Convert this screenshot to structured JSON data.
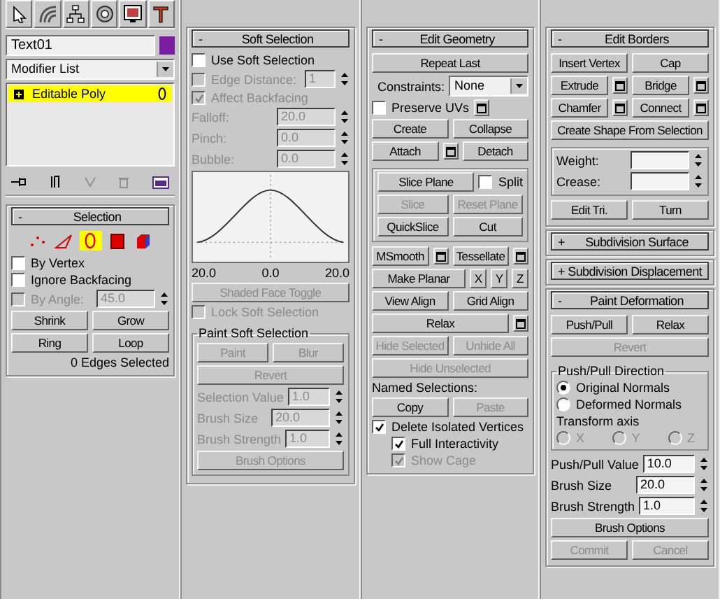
{
  "object": {
    "name": "Text01",
    "color": "#7b1fa2"
  },
  "modifier_list": {
    "value": "Modifier List"
  },
  "stack": [
    {
      "label": "Editable Poly",
      "selected": true
    }
  ],
  "columns": [
    {
      "rollouts": [
        {
          "toggle": "-",
          "title": "Selection",
          "items": [
            {
              "kind": "subobjects",
              "levels": [
                {
                  "kind": "vertex",
                  "selected": false
                },
                {
                  "kind": "edge",
                  "selected": false
                },
                {
                  "kind": "border",
                  "selected": true
                },
                {
                  "kind": "polygon",
                  "selected": false
                },
                {
                  "kind": "element",
                  "selected": false
                }
              ]
            },
            {
              "kind": "checkbox",
              "label": "By Vertex",
              "checked": false,
              "disabled": false
            },
            {
              "kind": "checkbox",
              "label": "Ignore Backfacing",
              "checked": false,
              "disabled": false
            },
            {
              "kind": "checkspinner",
              "label": "By Angle:",
              "value": "45.0",
              "checked": false,
              "disabled": true
            },
            {
              "kind": "row",
              "cells": [
                {
                  "kind": "button",
                  "label": "Shrink",
                  "disabled": false
                },
                {
                  "kind": "button",
                  "label": "Grow",
                  "disabled": false
                }
              ]
            },
            {
              "kind": "row",
              "cells": [
                {
                  "kind": "button",
                  "label": "Ring",
                  "disabled": false
                },
                {
                  "kind": "button",
                  "label": "Loop",
                  "disabled": false
                }
              ]
            },
            {
              "kind": "label",
              "text": "0 Edges Selected",
              "disabled": false
            }
          ]
        }
      ]
    },
    {
      "rollouts": [
        {
          "toggle": "-",
          "title": "Soft Selection",
          "items": [
            {
              "kind": "checkbox",
              "label": "Use Soft Selection",
              "checked": false,
              "disabled": false
            },
            {
              "kind": "checkspinner",
              "label": "Edge Distance:",
              "value": "1",
              "checked": false,
              "disabled": true
            },
            {
              "kind": "checkbox",
              "label": "Affect Backfacing",
              "checked": true,
              "disabled": true
            },
            {
              "kind": "spinner",
              "label": "Falloff:",
              "value": "20.0",
              "disabled": true
            },
            {
              "kind": "spinner",
              "label": "Pinch:",
              "value": "0.0",
              "disabled": true
            },
            {
              "kind": "spinner",
              "label": "Bubble:",
              "value": "0.0",
              "disabled": true
            },
            {
              "kind": "curve",
              "labels": [
                "20.0",
                "0.0",
                "20.0"
              ]
            },
            {
              "kind": "row",
              "cells": [
                {
                  "kind": "button",
                  "label": "Shaded Face Toggle",
                  "disabled": true
                }
              ]
            },
            {
              "kind": "checkbox",
              "label": "Lock Soft Selection",
              "checked": false,
              "disabled": true
            },
            {
              "kind": "group",
              "title": "Paint Soft Selection",
              "items": [
                {
                  "kind": "row",
                  "cells": [
                    {
                      "kind": "button",
                      "label": "Paint",
                      "disabled": true
                    },
                    {
                      "kind": "button",
                      "label": "Blur",
                      "disabled": true
                    }
                  ]
                },
                {
                  "kind": "row",
                  "cells": [
                    {
                      "kind": "button",
                      "label": "Revert",
                      "disabled": true
                    }
                  ]
                },
                {
                  "kind": "spinner",
                  "label": "Selection Value",
                  "value": "1.0",
                  "disabled": true
                },
                {
                  "kind": "spinner",
                  "label": "Brush Size",
                  "value": "20.0",
                  "disabled": true
                },
                {
                  "kind": "spinner",
                  "label": "Brush Strength",
                  "value": "1.0",
                  "disabled": true
                },
                {
                  "kind": "row",
                  "cells": [
                    {
                      "kind": "button",
                      "label": "Brush Options",
                      "disabled": true
                    }
                  ]
                }
              ]
            }
          ]
        }
      ]
    },
    {
      "rollouts": [
        {
          "toggle": "-",
          "title": "Edit Geometry",
          "items": [
            {
              "kind": "row",
              "cells": [
                {
                  "kind": "button",
                  "label": "Repeat Last",
                  "disabled": false
                }
              ]
            },
            {
              "kind": "dropdown",
              "label": "Constraints:",
              "value": "None"
            },
            {
              "kind": "row",
              "cells": [
                {
                  "kind": "checkbox",
                  "label": "Preserve UVs",
                  "checked": false,
                  "disabled": false
                },
                {
                  "kind": "settings",
                  "disabled": false
                }
              ]
            },
            {
              "kind": "row",
              "cells": [
                {
                  "kind": "button",
                  "label": "Create",
                  "disabled": false
                },
                {
                  "kind": "button",
                  "label": "Collapse",
                  "disabled": false
                }
              ]
            },
            {
              "kind": "row",
              "cells": [
                {
                  "kind": "button",
                  "label": "Attach",
                  "disabled": false
                },
                {
                  "kind": "settings",
                  "disabled": false
                },
                {
                  "kind": "button",
                  "label": "Detach",
                  "disabled": false
                }
              ]
            },
            {
              "kind": "group",
              "items": [
                {
                  "kind": "row",
                  "cells": [
                    {
                      "kind": "button",
                      "label": "Slice Plane",
                      "disabled": false
                    },
                    {
                      "kind": "checkbox",
                      "label": "Split",
                      "checked": false,
                      "disabled": false
                    }
                  ]
                },
                {
                  "kind": "row",
                  "cells": [
                    {
                      "kind": "button",
                      "label": "Slice",
                      "disabled": true
                    },
                    {
                      "kind": "button",
                      "label": "Reset Plane",
                      "disabled": true
                    }
                  ]
                },
                {
                  "kind": "row",
                  "cells": [
                    {
                      "kind": "button",
                      "label": "QuickSlice",
                      "disabled": false
                    },
                    {
                      "kind": "button",
                      "label": "Cut",
                      "disabled": false
                    }
                  ]
                }
              ]
            },
            {
              "kind": "row",
              "cells": [
                {
                  "kind": "button",
                  "label": "MSmooth",
                  "disabled": false
                },
                {
                  "kind": "settings",
                  "disabled": false
                },
                {
                  "kind": "button",
                  "label": "Tessellate",
                  "disabled": false
                },
                {
                  "kind": "settings",
                  "disabled": false
                }
              ]
            },
            {
              "kind": "row",
              "cells": [
                {
                  "kind": "button",
                  "label": "Make Planar",
                  "disabled": false
                },
                {
                  "kind": "small",
                  "label": "X",
                  "disabled": false
                },
                {
                  "kind": "small",
                  "label": "Y",
                  "disabled": false
                },
                {
                  "kind": "small",
                  "label": "Z",
                  "disabled": false
                }
              ]
            },
            {
              "kind": "row",
              "cells": [
                {
                  "kind": "button",
                  "label": "View Align",
                  "disabled": false
                },
                {
                  "kind": "button",
                  "label": "Grid Align",
                  "disabled": false
                }
              ]
            },
            {
              "kind": "centerrow",
              "cells": [
                {
                  "kind": "button",
                  "label": "Relax",
                  "disabled": false
                },
                {
                  "kind": "settings",
                  "disabled": false
                }
              ]
            },
            {
              "kind": "row",
              "cells": [
                {
                  "kind": "button",
                  "label": "Hide Selected",
                  "disabled": true
                },
                {
                  "kind": "button",
                  "label": "Unhide All",
                  "disabled": true
                }
              ]
            },
            {
              "kind": "centerrow",
              "cells": [
                {
                  "kind": "button",
                  "label": "Hide Unselected",
                  "disabled": true
                }
              ]
            },
            {
              "kind": "label",
              "text": "Named Selections:",
              "disabled": false
            },
            {
              "kind": "row",
              "cells": [
                {
                  "kind": "button",
                  "label": "Copy",
                  "disabled": false
                },
                {
                  "kind": "button",
                  "label": "Paste",
                  "disabled": true
                }
              ]
            },
            {
              "kind": "checkbox",
              "label": "Delete Isolated Vertices",
              "checked": true,
              "disabled": false
            },
            {
              "kind": "indent",
              "items": [
                {
                  "kind": "checkbox",
                  "label": "Full Interactivity",
                  "checked": true,
                  "disabled": false
                },
                {
                  "kind": "checkbox",
                  "label": "Show Cage",
                  "checked": true,
                  "disabled": true
                }
              ]
            }
          ]
        }
      ]
    },
    {
      "rollouts": [
        {
          "toggle": "-",
          "title": "Edit Borders",
          "items": [
            {
              "kind": "row",
              "cells": [
                {
                  "kind": "button",
                  "label": "Insert Vertex",
                  "disabled": false
                },
                {
                  "kind": "button",
                  "label": "Cap",
                  "disabled": false
                }
              ]
            },
            {
              "kind": "row",
              "cells": [
                {
                  "kind": "button",
                  "label": "Extrude",
                  "disabled": false
                },
                {
                  "kind": "settings",
                  "disabled": false
                },
                {
                  "kind": "button",
                  "label": "Bridge",
                  "disabled": false
                },
                {
                  "kind": "settings",
                  "disabled": false
                }
              ]
            },
            {
              "kind": "row",
              "cells": [
                {
                  "kind": "button",
                  "label": "Chamfer",
                  "disabled": false
                },
                {
                  "kind": "settings",
                  "disabled": false
                },
                {
                  "kind": "button",
                  "label": "Connect",
                  "disabled": false
                },
                {
                  "kind": "settings",
                  "disabled": false
                }
              ]
            },
            {
              "kind": "row",
              "cells": [
                {
                  "kind": "button",
                  "label": "Create Shape From Selection",
                  "disabled": false
                }
              ]
            },
            {
              "kind": "group",
              "items": [
                {
                  "kind": "spinner",
                  "label": "Weight:",
                  "value": "",
                  "disabled": false
                },
                {
                  "kind": "spinner",
                  "label": "Crease:",
                  "value": "",
                  "disabled": false
                }
              ]
            },
            {
              "kind": "row",
              "cells": [
                {
                  "kind": "button",
                  "label": "Edit Tri.",
                  "disabled": false
                },
                {
                  "kind": "button",
                  "label": "Turn",
                  "disabled": false
                }
              ]
            }
          ]
        },
        {
          "toggle": "+",
          "title": "Subdivision Surface"
        },
        {
          "toggle": "+",
          "title": "Subdivision Displacement"
        },
        {
          "toggle": "-",
          "title": "Paint Deformation",
          "items": [
            {
              "kind": "row",
              "cells": [
                {
                  "kind": "button",
                  "label": "Push/Pull",
                  "disabled": false
                },
                {
                  "kind": "button",
                  "label": "Relax",
                  "disabled": false
                }
              ]
            },
            {
              "kind": "row",
              "cells": [
                {
                  "kind": "button",
                  "label": "Revert",
                  "disabled": true
                }
              ]
            },
            {
              "kind": "group",
              "title": "Push/Pull Direction",
              "items": [
                {
                  "kind": "radio",
                  "label": "Original Normals",
                  "selected": true,
                  "disabled": false
                },
                {
                  "kind": "radio",
                  "label": "Deformed Normals",
                  "selected": false,
                  "disabled": false
                },
                {
                  "kind": "label",
                  "text": "Transform axis",
                  "disabled": false
                },
                {
                  "kind": "radiorow",
                  "options": [
                    {
                      "label": "X",
                      "selected": false,
                      "disabled": true
                    },
                    {
                      "label": "Y",
                      "selected": false,
                      "disabled": true
                    },
                    {
                      "label": "Z",
                      "selected": false,
                      "disabled": true
                    }
                  ]
                }
              ]
            },
            {
              "kind": "spinner",
              "label": "Push/Pull Value",
              "value": "10.0",
              "disabled": false
            },
            {
              "kind": "spinner",
              "label": "Brush Size",
              "value": "20.0",
              "disabled": false
            },
            {
              "kind": "spinner",
              "label": "Brush Strength",
              "value": "1.0",
              "disabled": false
            },
            {
              "kind": "row",
              "cells": [
                {
                  "kind": "button",
                  "label": "Brush Options",
                  "disabled": false
                }
              ]
            },
            {
              "kind": "row",
              "cells": [
                {
                  "kind": "button",
                  "label": "Commit",
                  "disabled": true
                },
                {
                  "kind": "button",
                  "label": "Cancel",
                  "disabled": true
                }
              ]
            }
          ]
        }
      ]
    }
  ]
}
